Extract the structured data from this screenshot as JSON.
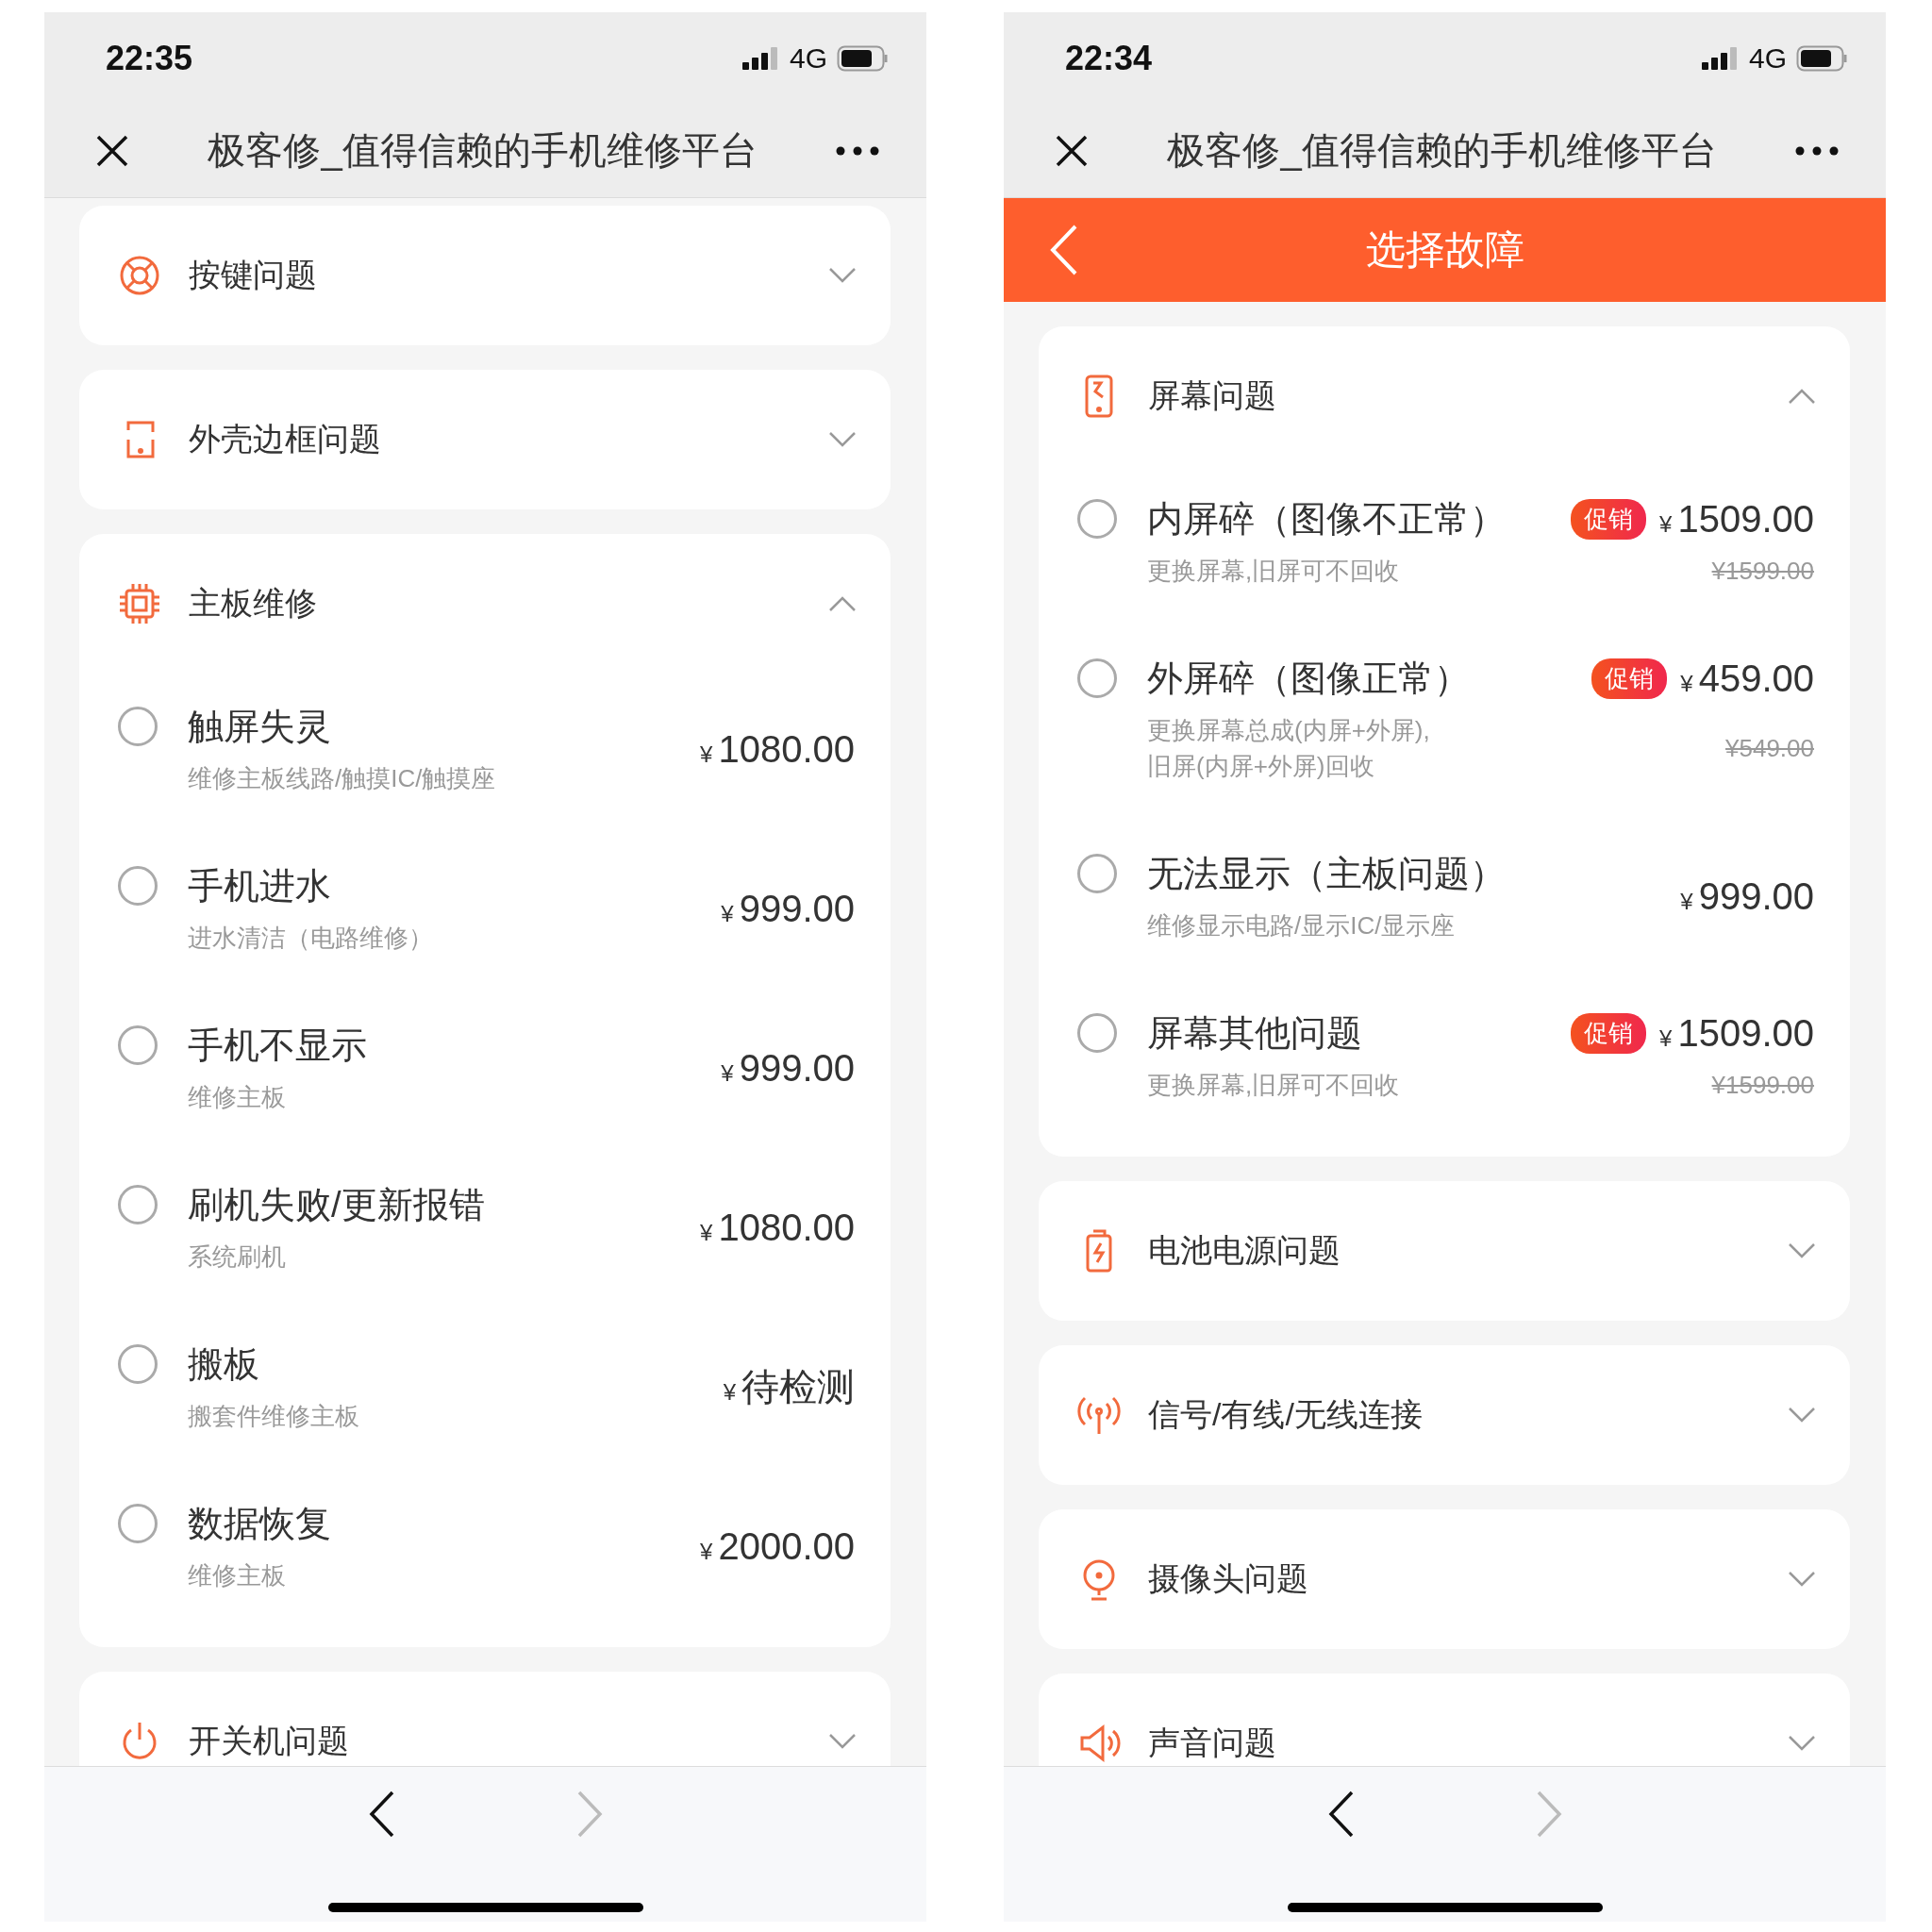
{
  "phones": [
    {
      "status_bar": {
        "time": "22:35",
        "network": "4G"
      },
      "nav_bar": {
        "title": "极客修_值得信赖的手机维修平台"
      },
      "categories": [
        {
          "kind": "buttons",
          "label": "按键问题",
          "expanded": false
        },
        {
          "kind": "frame",
          "label": "外壳边框问题",
          "expanded": false
        },
        {
          "kind": "board",
          "label": "主板维修",
          "expanded": true,
          "items": [
            {
              "title": "触屏失灵",
              "subtitle": "维修主板线路/触摸IC/触摸座",
              "currency": "¥",
              "price": "1080.00",
              "selected": false
            },
            {
              "title": "手机进水",
              "subtitle": "进水清洁（电路维修）",
              "currency": "¥",
              "price": "999.00",
              "selected": false
            },
            {
              "title": "手机不显示",
              "subtitle": "维修主板",
              "currency": "¥",
              "price": "999.00",
              "selected": false
            },
            {
              "title": "刷机失败/更新报错",
              "subtitle": "系统刷机",
              "currency": "¥",
              "price": "1080.00",
              "selected": false
            },
            {
              "title": "搬板",
              "subtitle": "搬套件维修主板",
              "currency": "¥",
              "price": "待检测",
              "selected": false
            },
            {
              "title": "数据恢复",
              "subtitle": "维修主板",
              "currency": "¥",
              "price": "2000.00",
              "selected": false
            }
          ]
        },
        {
          "kind": "power",
          "label": "开关机问题",
          "expanded": false
        }
      ],
      "toolbar": {
        "back": {
          "disabled": false
        },
        "forward": {
          "disabled": true
        }
      }
    },
    {
      "status_bar": {
        "time": "22:34",
        "network": "4G"
      },
      "nav_bar": {
        "title": "极客修_值得信赖的手机维修平台"
      },
      "header": {
        "title": "选择故障"
      },
      "categories": [
        {
          "kind": "screen",
          "label": "屏幕问题",
          "expanded": true,
          "items": [
            {
              "title": "内屏碎（图像不正常）",
              "subtitle": "更换屏幕,旧屏可不回收",
              "promo": "促销",
              "currency": "¥",
              "price": "1509.00",
              "original_price": "¥1599.00",
              "selected": false
            },
            {
              "title": "外屏碎（图像正常）",
              "subtitle": "更换屏幕总成(内屏+外屏),旧屏(内屏+外屏)回收",
              "promo": "促销",
              "currency": "¥",
              "price": "459.00",
              "original_price": "¥549.00",
              "selected": false
            },
            {
              "title": "无法显示（主板问题）",
              "subtitle": "维修显示电路/显示IC/显示座",
              "currency": "¥",
              "price": "999.00",
              "selected": false
            },
            {
              "title": "屏幕其他问题",
              "subtitle": "更换屏幕,旧屏可不回收",
              "promo": "促销",
              "currency": "¥",
              "price": "1509.00",
              "original_price": "¥1599.00",
              "selected": false
            }
          ]
        },
        {
          "kind": "battery",
          "label": "电池电源问题",
          "expanded": false
        },
        {
          "kind": "signal",
          "label": "信号/有线/无线连接",
          "expanded": false
        },
        {
          "kind": "camera",
          "label": "摄像头问题",
          "expanded": false
        },
        {
          "kind": "sound",
          "label": "声音问题",
          "expanded": false
        }
      ],
      "toolbar": {
        "back": {
          "disabled": false
        },
        "forward": {
          "disabled": true
        }
      }
    }
  ]
}
